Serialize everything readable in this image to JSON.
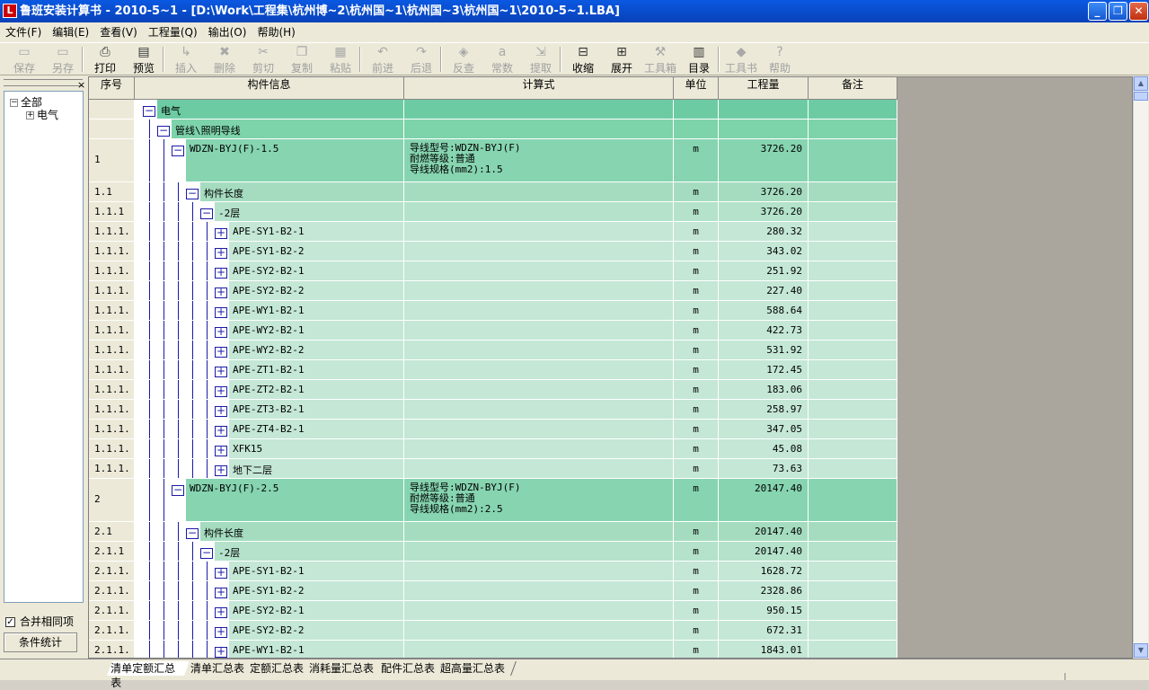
{
  "window": {
    "title": "鲁班安装计算书 - 2010-5~1 - [D:\\Work\\工程集\\杭州博~2\\杭州国~1\\杭州国~3\\杭州国~1\\2010-5~1.LBA]",
    "app_icon": "L"
  },
  "menu": [
    "文件(F)",
    "编辑(E)",
    "查看(V)",
    "工程量(Q)",
    "输出(O)",
    "帮助(H)"
  ],
  "toolbar": [
    {
      "label": "保存",
      "icon": "save-icon",
      "glyph": "▭",
      "enabled": false
    },
    {
      "label": "另存",
      "icon": "save-as-icon",
      "glyph": "▭",
      "enabled": false
    },
    {
      "label": "打印",
      "icon": "print-icon",
      "glyph": "⎙",
      "enabled": true
    },
    {
      "label": "预览",
      "icon": "preview-icon",
      "glyph": "▤",
      "enabled": true
    },
    {
      "label": "插入",
      "icon": "insert-icon",
      "glyph": "↳",
      "enabled": false
    },
    {
      "label": "删除",
      "icon": "delete-icon",
      "glyph": "✖",
      "enabled": false
    },
    {
      "label": "剪切",
      "icon": "cut-icon",
      "glyph": "✂",
      "enabled": false
    },
    {
      "label": "复制",
      "icon": "copy-icon",
      "glyph": "❐",
      "enabled": false
    },
    {
      "label": "粘贴",
      "icon": "paste-icon",
      "glyph": "▦",
      "enabled": false
    },
    {
      "label": "前进",
      "icon": "undo-icon",
      "glyph": "↶",
      "enabled": false
    },
    {
      "label": "后退",
      "icon": "redo-icon",
      "glyph": "↷",
      "enabled": false
    },
    {
      "label": "反查",
      "icon": "lookup-icon",
      "glyph": "◈",
      "enabled": false
    },
    {
      "label": "常数",
      "icon": "constant-icon",
      "glyph": "a",
      "enabled": false
    },
    {
      "label": "提取",
      "icon": "extract-icon",
      "glyph": "⇲",
      "enabled": false
    },
    {
      "label": "收缩",
      "icon": "collapse-icon",
      "glyph": "⊟",
      "enabled": true
    },
    {
      "label": "展开",
      "icon": "expand-icon",
      "glyph": "⊞",
      "enabled": true
    },
    {
      "label": "工具箱",
      "icon": "toolbox-icon",
      "glyph": "⚒",
      "enabled": false
    },
    {
      "label": "目录",
      "icon": "catalog-icon",
      "glyph": "▥",
      "enabled": true
    },
    {
      "label": "工具书",
      "icon": "handbook-icon",
      "glyph": "◆",
      "enabled": false
    },
    {
      "label": "帮助",
      "icon": "help-icon",
      "glyph": "?",
      "enabled": false
    }
  ],
  "left_panel": {
    "close_glyph": "×",
    "tree": [
      {
        "label": "全部",
        "toggle": "−",
        "level": 0
      },
      {
        "label": "电气",
        "toggle": "+",
        "level": 1
      }
    ],
    "merge_checkbox": {
      "label": "合并相同项",
      "checked": true,
      "glyph": "✓"
    },
    "cond_button": "条件统计"
  },
  "table": {
    "columns": [
      "序号",
      "构件信息",
      "计算式",
      "单位",
      "工程量",
      "备注"
    ],
    "rows": [
      {
        "seq": "",
        "name": "电气",
        "level": 0,
        "toggle": "−",
        "formula": [],
        "unit": "",
        "qty": "",
        "color": "#6ccba3",
        "h": 22
      },
      {
        "seq": "",
        "name": "管线\\照明导线",
        "level": 1,
        "toggle": "−",
        "formula": [],
        "unit": "",
        "qty": "",
        "color": "#7dd3aa",
        "h": 22
      },
      {
        "seq": "1",
        "name": "WDZN-BYJ(F)-1.5",
        "level": 2,
        "toggle": "−",
        "formula": [
          "导线型号:WDZN-BYJ(F)",
          "耐燃等级:普通",
          "导线规格(mm2):1.5"
        ],
        "unit": "m",
        "qty": "3726.20",
        "color": "#86d4b0",
        "h": 48
      },
      {
        "seq": "1.1",
        "name": "构件长度",
        "level": 3,
        "toggle": "−",
        "formula": [],
        "unit": "m",
        "qty": "3726.20",
        "color": "#a5dcc0",
        "h": 22
      },
      {
        "seq": "1.1.1",
        "name": "-2层",
        "level": 4,
        "toggle": "−",
        "formula": [],
        "unit": "m",
        "qty": "3726.20",
        "color": "#b4e2cb",
        "h": 22
      },
      {
        "seq": "1.1.1.",
        "name": "APE-SY1-B2-1",
        "level": 5,
        "toggle": "+",
        "formula": [],
        "unit": "m",
        "qty": "280.32",
        "color": "#c4e7d6",
        "h": 22
      },
      {
        "seq": "1.1.1.",
        "name": "APE-SY1-B2-2",
        "level": 5,
        "toggle": "+",
        "formula": [],
        "unit": "m",
        "qty": "343.02",
        "color": "#c4e7d6",
        "h": 22
      },
      {
        "seq": "1.1.1.",
        "name": "APE-SY2-B2-1",
        "level": 5,
        "toggle": "+",
        "formula": [],
        "unit": "m",
        "qty": "251.92",
        "color": "#c4e7d6",
        "h": 22
      },
      {
        "seq": "1.1.1.",
        "name": "APE-SY2-B2-2",
        "level": 5,
        "toggle": "+",
        "formula": [],
        "unit": "m",
        "qty": "227.40",
        "color": "#c4e7d6",
        "h": 22
      },
      {
        "seq": "1.1.1.",
        "name": "APE-WY1-B2-1",
        "level": 5,
        "toggle": "+",
        "formula": [],
        "unit": "m",
        "qty": "588.64",
        "color": "#c4e7d6",
        "h": 22
      },
      {
        "seq": "1.1.1.",
        "name": "APE-WY2-B2-1",
        "level": 5,
        "toggle": "+",
        "formula": [],
        "unit": "m",
        "qty": "422.73",
        "color": "#c4e7d6",
        "h": 22
      },
      {
        "seq": "1.1.1.",
        "name": "APE-WY2-B2-2",
        "level": 5,
        "toggle": "+",
        "formula": [],
        "unit": "m",
        "qty": "531.92",
        "color": "#c4e7d6",
        "h": 22
      },
      {
        "seq": "1.1.1.",
        "name": "APE-ZT1-B2-1",
        "level": 5,
        "toggle": "+",
        "formula": [],
        "unit": "m",
        "qty": "172.45",
        "color": "#c4e7d6",
        "h": 22
      },
      {
        "seq": "1.1.1.",
        "name": "APE-ZT2-B2-1",
        "level": 5,
        "toggle": "+",
        "formula": [],
        "unit": "m",
        "qty": "183.06",
        "color": "#c4e7d6",
        "h": 22
      },
      {
        "seq": "1.1.1.",
        "name": "APE-ZT3-B2-1",
        "level": 5,
        "toggle": "+",
        "formula": [],
        "unit": "m",
        "qty": "258.97",
        "color": "#c4e7d6",
        "h": 22
      },
      {
        "seq": "1.1.1.",
        "name": "APE-ZT4-B2-1",
        "level": 5,
        "toggle": "+",
        "formula": [],
        "unit": "m",
        "qty": "347.05",
        "color": "#c4e7d6",
        "h": 22
      },
      {
        "seq": "1.1.1.",
        "name": "XFK15",
        "level": 5,
        "toggle": "+",
        "formula": [],
        "unit": "m",
        "qty": "45.08",
        "color": "#c4e7d6",
        "h": 22
      },
      {
        "seq": "1.1.1.",
        "name": "地下二层",
        "level": 5,
        "toggle": "+",
        "formula": [],
        "unit": "m",
        "qty": "73.63",
        "color": "#c4e7d6",
        "h": 22
      },
      {
        "seq": "2",
        "name": "WDZN-BYJ(F)-2.5",
        "level": 2,
        "toggle": "−",
        "formula": [
          "导线型号:WDZN-BYJ(F)",
          "耐燃等级:普通",
          "导线规格(mm2):2.5"
        ],
        "unit": "m",
        "qty": "20147.40",
        "color": "#86d4b0",
        "h": 48
      },
      {
        "seq": "2.1",
        "name": "构件长度",
        "level": 3,
        "toggle": "−",
        "formula": [],
        "unit": "m",
        "qty": "20147.40",
        "color": "#a5dcc0",
        "h": 22
      },
      {
        "seq": "2.1.1",
        "name": "-2层",
        "level": 4,
        "toggle": "−",
        "formula": [],
        "unit": "m",
        "qty": "20147.40",
        "color": "#b4e2cb",
        "h": 22
      },
      {
        "seq": "2.1.1.",
        "name": "APE-SY1-B2-1",
        "level": 5,
        "toggle": "+",
        "formula": [],
        "unit": "m",
        "qty": "1628.72",
        "color": "#c4e7d6",
        "h": 22
      },
      {
        "seq": "2.1.1.",
        "name": "APE-SY1-B2-2",
        "level": 5,
        "toggle": "+",
        "formula": [],
        "unit": "m",
        "qty": "2328.86",
        "color": "#c4e7d6",
        "h": 22
      },
      {
        "seq": "2.1.1.",
        "name": "APE-SY2-B2-1",
        "level": 5,
        "toggle": "+",
        "formula": [],
        "unit": "m",
        "qty": "950.15",
        "color": "#c4e7d6",
        "h": 22
      },
      {
        "seq": "2.1.1.",
        "name": "APE-SY2-B2-2",
        "level": 5,
        "toggle": "+",
        "formula": [],
        "unit": "m",
        "qty": "672.31",
        "color": "#c4e7d6",
        "h": 22
      },
      {
        "seq": "2.1.1.",
        "name": "APE-WY1-B2-1",
        "level": 5,
        "toggle": "+",
        "formula": [],
        "unit": "m",
        "qty": "1843.01",
        "color": "#c4e7d6",
        "h": 22
      }
    ]
  },
  "tabs": [
    "清单定额汇总表",
    "清单汇总表",
    "定额汇总表",
    "消耗量汇总表",
    "配件汇总表",
    "超高量汇总表"
  ],
  "active_tab": 0
}
